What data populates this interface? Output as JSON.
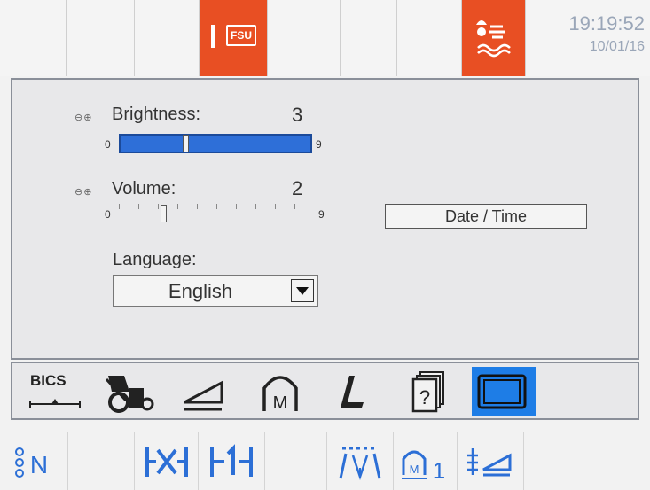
{
  "status_bar": {
    "alert_label": "FSU",
    "time": "19:19:52",
    "date": "10/01/16",
    "accent_color": "#e84f23"
  },
  "settings": {
    "brightness": {
      "label": "Brightness:",
      "value": "3",
      "min_label": "0",
      "max_label": "9",
      "level": 3,
      "max": 9,
      "step_icon": "plus-minus-icon"
    },
    "volume": {
      "label": "Volume:",
      "value": "2",
      "min_label": "0",
      "max_label": "9",
      "level": 2,
      "max": 9,
      "step_icon": "plus-minus-icon"
    },
    "date_time_button": "Date / Time",
    "language": {
      "label": "Language:",
      "selected": "English"
    }
  },
  "toolbar": {
    "bics_label": "BICS",
    "tools": [
      "bics-icon",
      "tractor-icon",
      "wedge-icon",
      "memory-icon",
      "lift-icon",
      "help-icon",
      "display-settings-icon"
    ],
    "selected_tool": "display-settings-icon",
    "selected_color": "#1e7de6"
  },
  "function_bar": {
    "neutral_label": "N",
    "memory_label": "1",
    "icons": [
      "neutral-icon",
      "x-balance-icon",
      "one-balance-icon",
      "scraper-icon",
      "memory-one-icon",
      "angle-icon"
    ],
    "icon_color": "#2c6fd6"
  }
}
